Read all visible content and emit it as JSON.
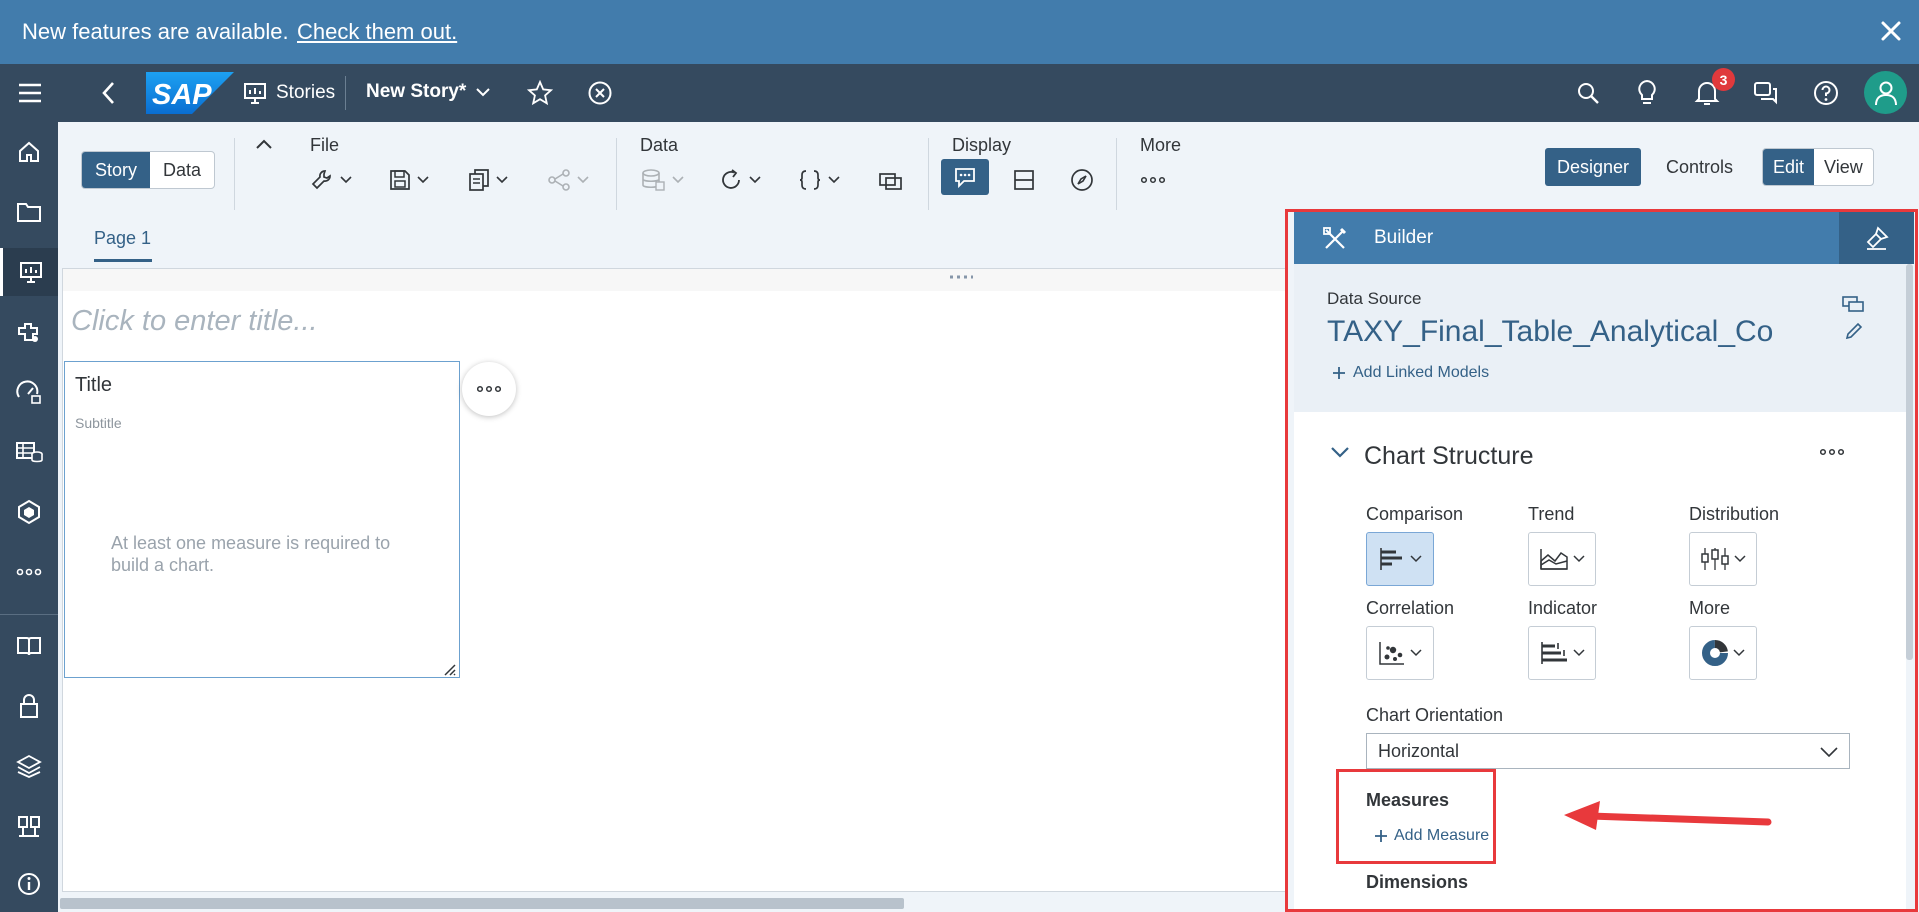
{
  "banner": {
    "message": "New features are available.",
    "link": "Check them out."
  },
  "shell": {
    "app_label": "Stories",
    "story_title": "New Story",
    "story_modified_mark": "*",
    "notification_count": "3"
  },
  "toolbar": {
    "mode_story": "Story",
    "mode_data": "Data",
    "group_file": "File",
    "group_data": "Data",
    "group_display": "Display",
    "group_more": "More",
    "designer": "Designer",
    "controls": "Controls",
    "edit": "Edit",
    "view": "View"
  },
  "page": {
    "tab": "Page 1",
    "title_placeholder": "Click to enter title...",
    "widget": {
      "title": "Title",
      "subtitle": "Subtitle",
      "message_line1": "At least one measure is required to",
      "message_line2": "build a chart."
    }
  },
  "builder": {
    "header": "Builder",
    "data_source_label": "Data Source",
    "data_source_name": "TAXY_Final_Table_Analytical_Co",
    "add_linked_models": "Add Linked Models",
    "chart_structure": "Chart Structure",
    "chart_types": [
      {
        "label": "Comparison",
        "icon": "bar-chart-icon"
      },
      {
        "label": "Trend",
        "icon": "area-chart-icon"
      },
      {
        "label": "Distribution",
        "icon": "boxplot-icon"
      },
      {
        "label": "Correlation",
        "icon": "scatter-icon"
      },
      {
        "label": "Indicator",
        "icon": "bullet-chart-icon"
      },
      {
        "label": "More",
        "icon": "donut-icon"
      }
    ],
    "orientation_label": "Chart Orientation",
    "orientation_value": "Horizontal",
    "measures_label": "Measures",
    "add_measure": "Add Measure",
    "dimensions_label": "Dimensions"
  },
  "colors": {
    "shell": "#354a5f",
    "banner": "#427cac",
    "accent": "#346187",
    "highlight": "#e8393c",
    "badge": "#e0393c",
    "avatar": "#1f9c8a"
  }
}
